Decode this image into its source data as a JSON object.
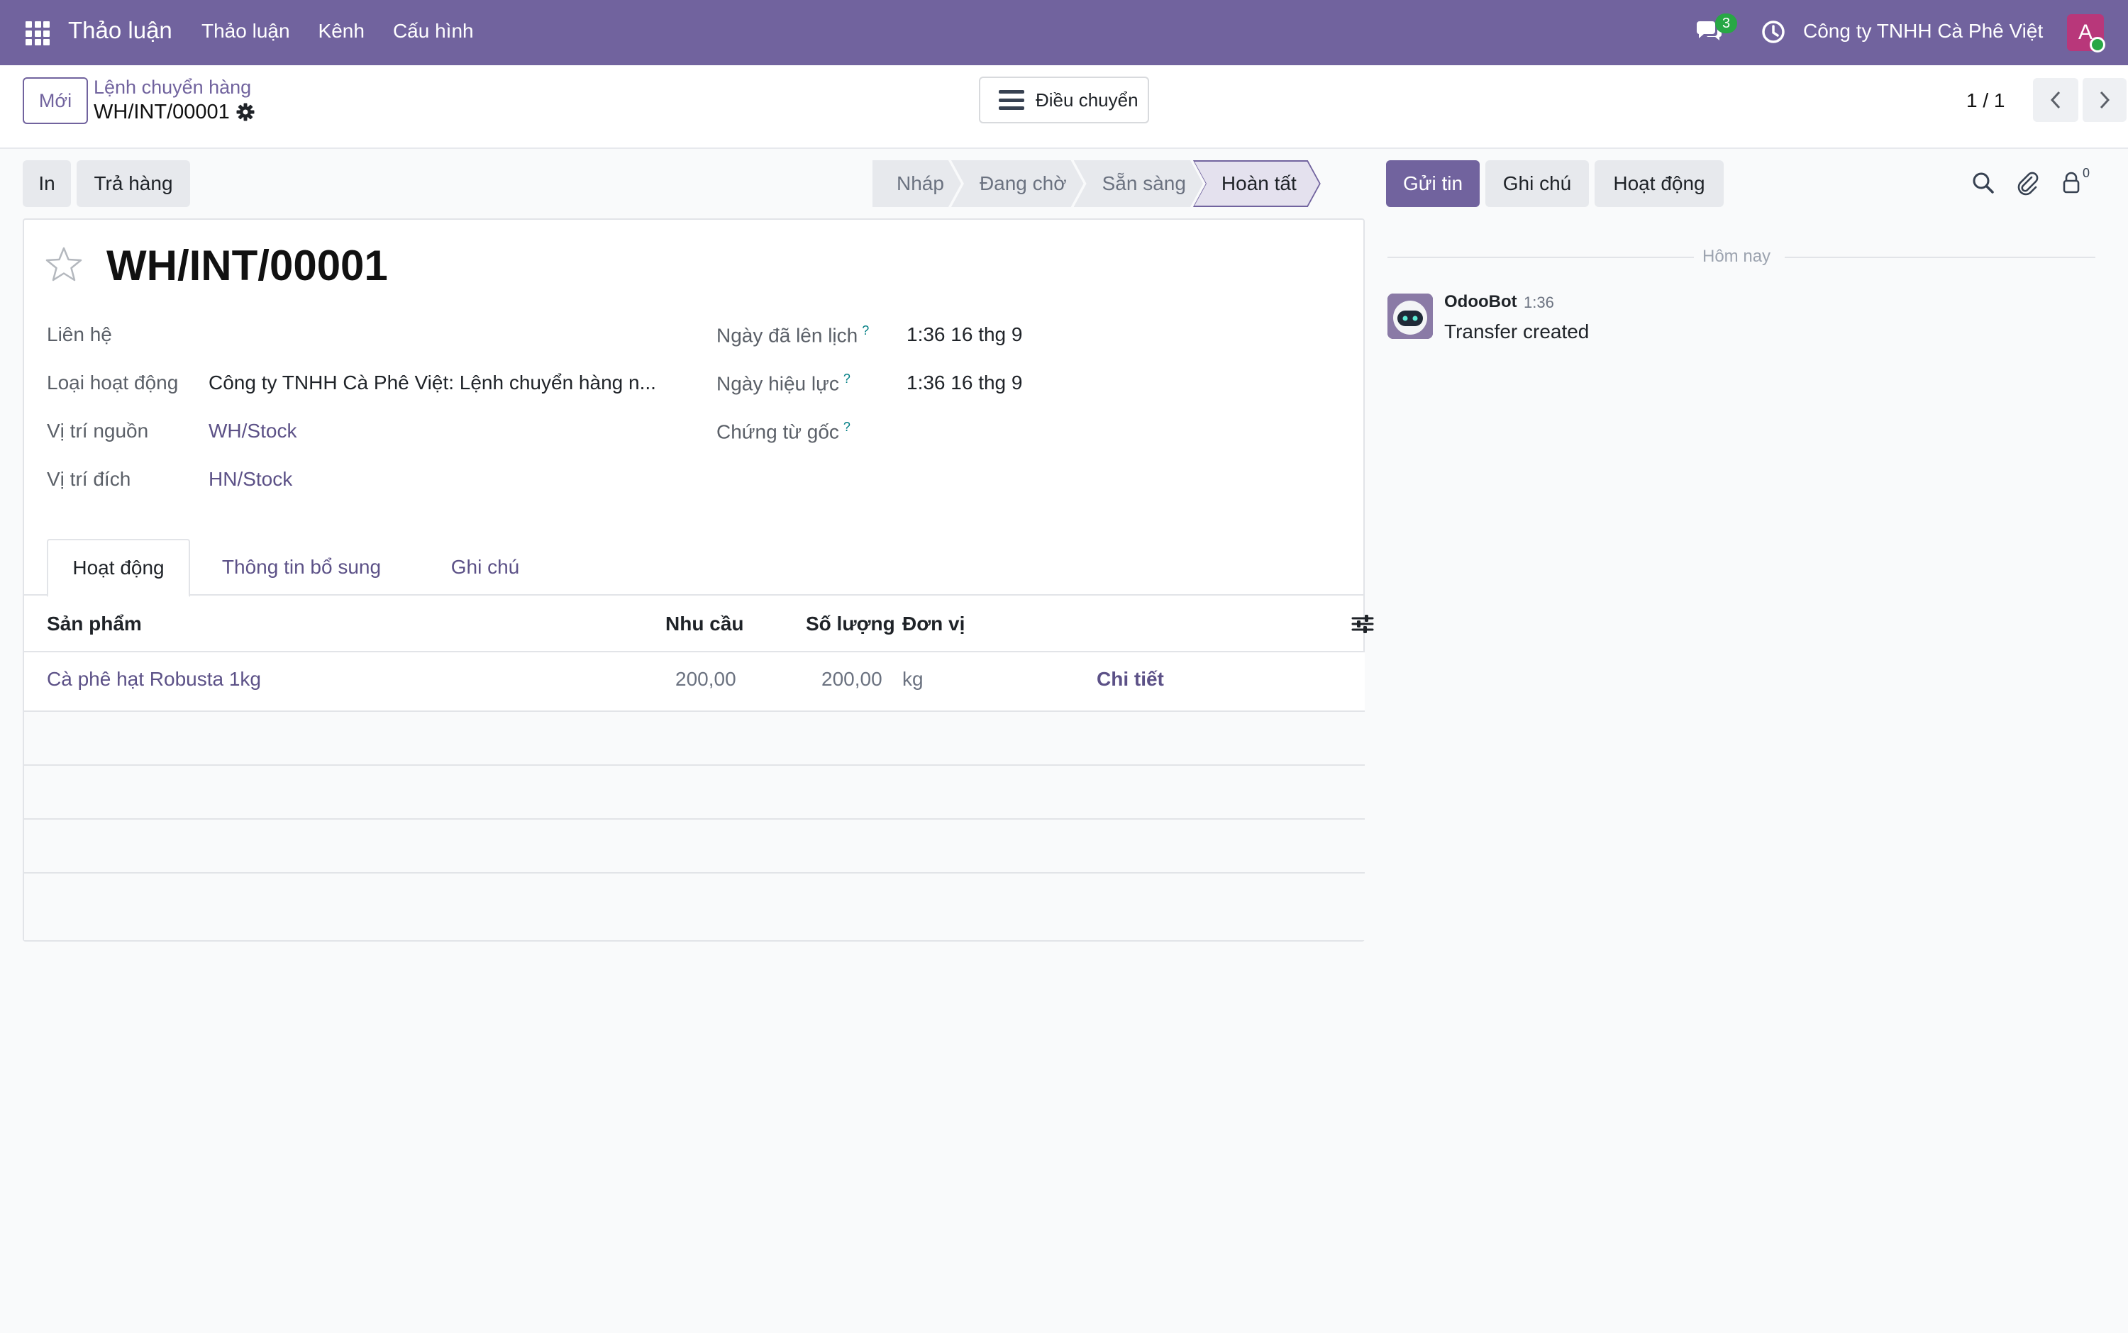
{
  "navbar": {
    "brand": "Thảo luận",
    "menu": [
      "Thảo luận",
      "Kênh",
      "Cấu hình"
    ],
    "chat_count": "3",
    "company": "Công ty TNHH Cà Phê Việt",
    "avatar_letter": "A",
    "accent_color": "#71639e"
  },
  "control_panel": {
    "new_label": "Mới",
    "breadcrumb_parent": "Lệnh chuyển hàng",
    "breadcrumb_current": "WH/INT/00001",
    "transfer_label": "Điều chuyển",
    "pager": "1 / 1"
  },
  "actions": {
    "print_label": "In",
    "return_label": "Trả hàng"
  },
  "statusbar": {
    "stages": [
      "Nháp",
      "Đang chờ",
      "Sẵn sàng",
      "Hoàn tất"
    ],
    "active": "Hoàn tất"
  },
  "form": {
    "title": "WH/INT/00001",
    "left_fields": [
      {
        "label": "Liên hệ",
        "value": ""
      },
      {
        "label": "Loại hoạt động",
        "value": "Công ty TNHH Cà Phê Việt: Lệnh chuyển hàng n..."
      },
      {
        "label": "Vị trí nguồn",
        "value": "WH/Stock"
      },
      {
        "label": "Vị trí đích",
        "value": "HN/Stock"
      }
    ],
    "right_fields": [
      {
        "label": "Ngày đã lên lịch",
        "value": "1:36 16 thg 9"
      },
      {
        "label": "Ngày hiệu lực",
        "value": "1:36 16 thg 9"
      },
      {
        "label": "Chứng từ gốc",
        "value": ""
      }
    ],
    "help_mark": "?",
    "tabs": [
      "Hoạt động",
      "Thông tin bổ sung",
      "Ghi chú"
    ],
    "table": {
      "headers": [
        "Sản phẩm",
        "Nhu cầu",
        "Số lượng",
        "Đơn vị"
      ],
      "rows": [
        {
          "product": "Cà phê hạt Robusta 1kg",
          "demand": "200,00",
          "quantity": "200,00",
          "uom": "kg",
          "details": "Chi tiết"
        }
      ]
    }
  },
  "chatter": {
    "send_label": "Gửi tin",
    "note_label": "Ghi chú",
    "activity_label": "Hoạt động",
    "follower_count": "0",
    "date_separator": "Hôm nay",
    "messages": [
      {
        "author": "OdooBot",
        "time": "1:36",
        "body": "Transfer created"
      }
    ]
  }
}
